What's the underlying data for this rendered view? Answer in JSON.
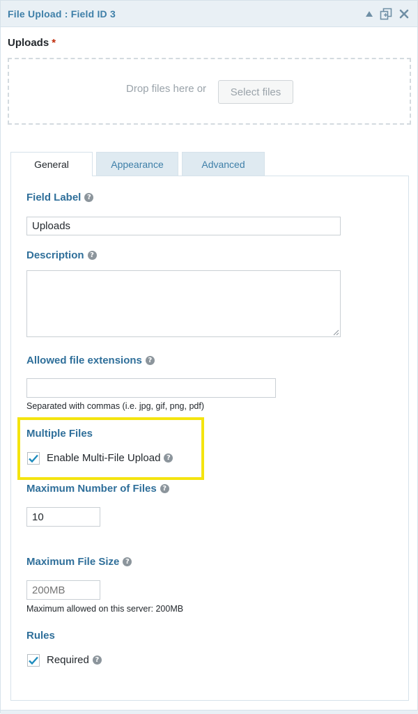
{
  "titlebar": {
    "title": "File Upload : Field ID 3",
    "icons": [
      "collapse-triangle-icon",
      "duplicate-icon",
      "close-icon"
    ]
  },
  "preview": {
    "label": "Uploads",
    "required_mark": "*",
    "drop_text": "Drop files here or",
    "select_button": "Select files"
  },
  "tabs": [
    {
      "label": "General",
      "active": true
    },
    {
      "label": "Appearance",
      "active": false
    },
    {
      "label": "Advanced",
      "active": false
    }
  ],
  "general": {
    "field_label": {
      "label": "Field Label",
      "value": "Uploads"
    },
    "description": {
      "label": "Description",
      "value": ""
    },
    "extensions": {
      "label": "Allowed file extensions",
      "value": "",
      "hint": "Separated with commas (i.e. jpg, gif, png, pdf)"
    },
    "multiple_files": {
      "label": "Multiple Files",
      "checkbox_label": "Enable Multi-File Upload",
      "checked": true
    },
    "max_files": {
      "label": "Maximum Number of Files",
      "value": "10"
    },
    "max_size": {
      "label": "Maximum File Size",
      "placeholder": "200MB",
      "hint": "Maximum allowed on this server: 200MB"
    },
    "rules": {
      "label": "Rules",
      "checkbox_label": "Required",
      "checked": true
    }
  },
  "colors": {
    "accent": "#2f6f9a",
    "title": "#3e7fa8",
    "highlight": "#f4e40f",
    "check": "#1e8cbe"
  }
}
